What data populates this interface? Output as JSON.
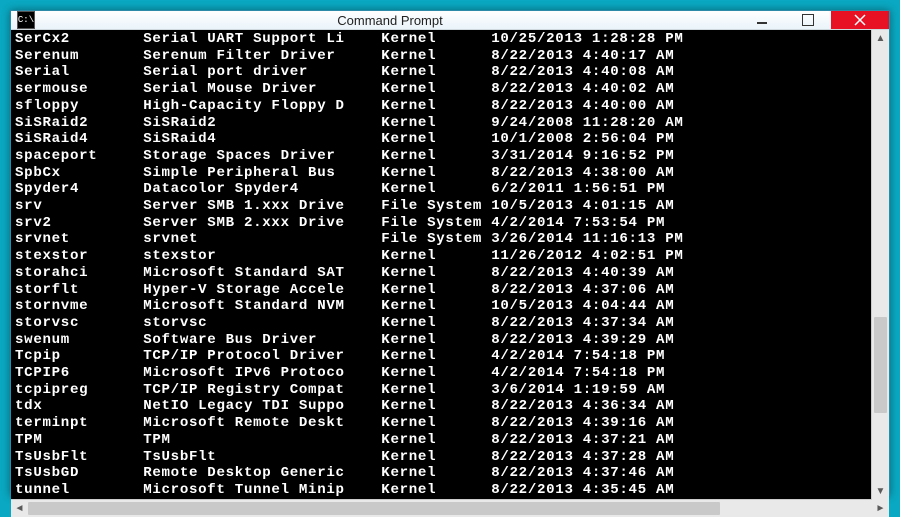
{
  "window": {
    "title": "Command Prompt",
    "sysicon_text": "C:\\",
    "buttons": {
      "min": "minimize",
      "max": "maximize",
      "close": "close"
    }
  },
  "columns": {
    "name_w": 14,
    "desc_w": 26,
    "type_w": 12
  },
  "rows": [
    {
      "name": "SerCx2",
      "desc": "Serial UART Support Li",
      "type": "Kernel",
      "date": "10/25/2013 1:28:28 PM"
    },
    {
      "name": "Serenum",
      "desc": "Serenum Filter Driver",
      "type": "Kernel",
      "date": "8/22/2013 4:40:17 AM"
    },
    {
      "name": "Serial",
      "desc": "Serial port driver",
      "type": "Kernel",
      "date": "8/22/2013 4:40:08 AM"
    },
    {
      "name": "sermouse",
      "desc": "Serial Mouse Driver",
      "type": "Kernel",
      "date": "8/22/2013 4:40:02 AM"
    },
    {
      "name": "sfloppy",
      "desc": "High-Capacity Floppy D",
      "type": "Kernel",
      "date": "8/22/2013 4:40:00 AM"
    },
    {
      "name": "SiSRaid2",
      "desc": "SiSRaid2",
      "type": "Kernel",
      "date": "9/24/2008 11:28:20 AM"
    },
    {
      "name": "SiSRaid4",
      "desc": "SiSRaid4",
      "type": "Kernel",
      "date": "10/1/2008 2:56:04 PM"
    },
    {
      "name": "spaceport",
      "desc": "Storage Spaces Driver",
      "type": "Kernel",
      "date": "3/31/2014 9:16:52 PM"
    },
    {
      "name": "SpbCx",
      "desc": "Simple Peripheral Bus",
      "type": "Kernel",
      "date": "8/22/2013 4:38:00 AM"
    },
    {
      "name": "Spyder4",
      "desc": "Datacolor Spyder4",
      "type": "Kernel",
      "date": "6/2/2011 1:56:51 PM"
    },
    {
      "name": "srv",
      "desc": "Server SMB 1.xxx Drive",
      "type": "File System",
      "date": "10/5/2013 4:01:15 AM"
    },
    {
      "name": "srv2",
      "desc": "Server SMB 2.xxx Drive",
      "type": "File System",
      "date": "4/2/2014 7:53:54 PM"
    },
    {
      "name": "srvnet",
      "desc": "srvnet",
      "type": "File System",
      "date": "3/26/2014 11:16:13 PM"
    },
    {
      "name": "stexstor",
      "desc": "stexstor",
      "type": "Kernel",
      "date": "11/26/2012 4:02:51 PM"
    },
    {
      "name": "storahci",
      "desc": "Microsoft Standard SAT",
      "type": "Kernel",
      "date": "8/22/2013 4:40:39 AM"
    },
    {
      "name": "storflt",
      "desc": "Hyper-V Storage Accele",
      "type": "Kernel",
      "date": "8/22/2013 4:37:06 AM"
    },
    {
      "name": "stornvme",
      "desc": "Microsoft Standard NVM",
      "type": "Kernel",
      "date": "10/5/2013 4:04:44 AM"
    },
    {
      "name": "storvsc",
      "desc": "storvsc",
      "type": "Kernel",
      "date": "8/22/2013 4:37:34 AM"
    },
    {
      "name": "swenum",
      "desc": "Software Bus Driver",
      "type": "Kernel",
      "date": "8/22/2013 4:39:29 AM"
    },
    {
      "name": "Tcpip",
      "desc": "TCP/IP Protocol Driver",
      "type": "Kernel",
      "date": "4/2/2014 7:54:18 PM"
    },
    {
      "name": "TCPIP6",
      "desc": "Microsoft IPv6 Protoco",
      "type": "Kernel",
      "date": "4/2/2014 7:54:18 PM"
    },
    {
      "name": "tcpipreg",
      "desc": "TCP/IP Registry Compat",
      "type": "Kernel",
      "date": "3/6/2014 1:19:59 AM"
    },
    {
      "name": "tdx",
      "desc": "NetIO Legacy TDI Suppo",
      "type": "Kernel",
      "date": "8/22/2013 4:36:34 AM"
    },
    {
      "name": "terminpt",
      "desc": "Microsoft Remote Deskt",
      "type": "Kernel",
      "date": "8/22/2013 4:39:16 AM"
    },
    {
      "name": "TPM",
      "desc": "TPM",
      "type": "Kernel",
      "date": "8/22/2013 4:37:21 AM"
    },
    {
      "name": "TsUsbFlt",
      "desc": "TsUsbFlt",
      "type": "Kernel",
      "date": "8/22/2013 4:37:28 AM"
    },
    {
      "name": "TsUsbGD",
      "desc": "Remote Desktop Generic",
      "type": "Kernel",
      "date": "8/22/2013 4:37:46 AM"
    },
    {
      "name": "tunnel",
      "desc": "Microsoft Tunnel Minip",
      "type": "Kernel",
      "date": "8/22/2013 4:35:45 AM"
    }
  ],
  "scroll": {
    "left_arrow": "◄",
    "right_arrow": "►",
    "up_arrow": "▲",
    "down_arrow": "▼"
  }
}
